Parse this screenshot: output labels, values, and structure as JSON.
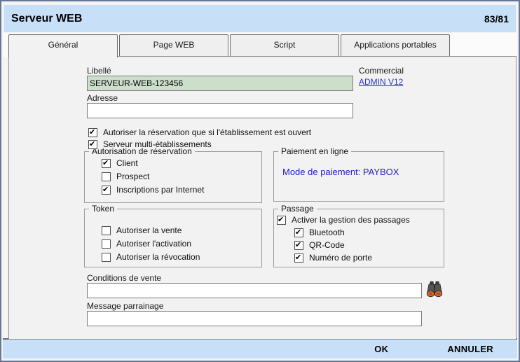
{
  "window": {
    "title": "Serveur WEB",
    "counter": "83/81"
  },
  "tabs": [
    {
      "label": "Général",
      "active": true
    },
    {
      "label": "Page WEB",
      "active": false
    },
    {
      "label": "Script",
      "active": false
    },
    {
      "label": "Applications portables",
      "active": false
    }
  ],
  "form": {
    "libelle": {
      "label": "Libellé",
      "value": "SERVEUR-WEB-123456"
    },
    "commercial": {
      "label": "Commercial",
      "link_text": "ADMIN V12"
    },
    "adresse": {
      "label": "Adresse",
      "value": ""
    },
    "checkbox_reservation": {
      "label": "Autoriser la réservation que si l'établissement est ouvert",
      "checked": true
    },
    "checkbox_multi": {
      "label": "Serveur multi-établissements",
      "checked": true
    },
    "conditions": {
      "label": "Conditions de vente",
      "value": ""
    },
    "parrainage": {
      "label": "Message parrainage",
      "value": ""
    }
  },
  "groups": {
    "autorisation": {
      "title": "Autorisation de réservation",
      "items": [
        {
          "label": "Client",
          "checked": true
        },
        {
          "label": "Prospect",
          "checked": false
        },
        {
          "label": "Inscriptions par Internet",
          "checked": true
        }
      ]
    },
    "paiement": {
      "title": "Paiement en ligne",
      "text": "Mode de paiement: PAYBOX"
    },
    "token": {
      "title": "Token",
      "items": [
        {
          "label": "Autoriser la vente",
          "checked": false
        },
        {
          "label": "Autoriser l'activation",
          "checked": false
        },
        {
          "label": "Autoriser la révocation",
          "checked": false
        }
      ]
    },
    "passage": {
      "title": "Passage",
      "main": {
        "label": "Activer la gestion des passages",
        "checked": true
      },
      "items": [
        {
          "label": "Bluetooth",
          "checked": true
        },
        {
          "label": "QR-Code",
          "checked": true
        },
        {
          "label": "Numéro de porte",
          "checked": true
        }
      ]
    }
  },
  "footer": {
    "ok_label": "OK",
    "cancel_label": "ANNULER"
  },
  "icons": {
    "conditions_lookup": "binoculars-icon"
  },
  "colors": {
    "header_bg": "#c8dff8",
    "footer_bg": "#c8dff8",
    "panel_bg": "#f2f2f2",
    "libelle_field_bg": "#cbdfca",
    "link_blue": "#2b35c8",
    "payment_text_blue": "#2120cc"
  }
}
